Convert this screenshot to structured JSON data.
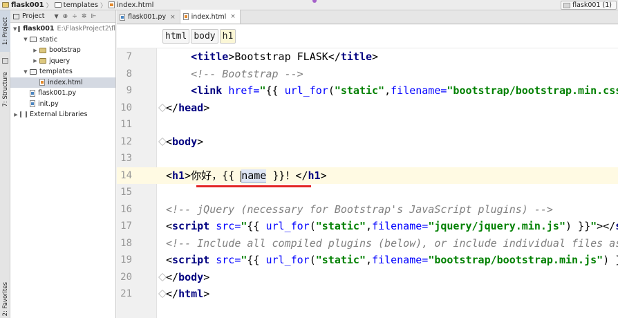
{
  "breadcrumb": [
    {
      "label": "flask001",
      "icon": "folder-icon",
      "bold": true
    },
    {
      "label": "templates",
      "icon": "folder-outline-icon",
      "bold": false
    },
    {
      "label": "index.html",
      "icon": "html-file-icon",
      "bold": false
    }
  ],
  "run_config": {
    "label": "flask001 (1)"
  },
  "toolstrip": {
    "project_tab": "1: Project",
    "structure_tab": "7: Structure",
    "favorites_tab": "2: Favorites"
  },
  "project_panel": {
    "title": "Project",
    "tree": [
      {
        "label": "flask001",
        "hint": "E:\\FlaskProject2\\fl",
        "type": "folder-open",
        "depth": 0,
        "expanded": true,
        "bold": true
      },
      {
        "label": "static",
        "type": "folder-open",
        "depth": 1,
        "expanded": true
      },
      {
        "label": "bootstrap",
        "type": "folder",
        "depth": 2,
        "expanded": false
      },
      {
        "label": "jquery",
        "type": "folder",
        "depth": 2,
        "expanded": false
      },
      {
        "label": "templates",
        "type": "folder-open",
        "depth": 1,
        "expanded": true
      },
      {
        "label": "index.html",
        "type": "html",
        "depth": 2,
        "selected": true
      },
      {
        "label": "flask001.py",
        "type": "py",
        "depth": 1
      },
      {
        "label": "init.py",
        "type": "py",
        "depth": 1
      },
      {
        "label": "External Libraries",
        "type": "lib",
        "depth": 0,
        "expanded": false
      }
    ]
  },
  "tabs": [
    {
      "label": "flask001.py",
      "icon": "python-file-icon",
      "active": false
    },
    {
      "label": "index.html",
      "icon": "html-file-icon",
      "active": true
    }
  ],
  "tag_breadcrumb": [
    "html",
    "body",
    "h1"
  ],
  "code_lines": [
    {
      "n": "7",
      "fold": false,
      "parts": [
        [
          "tg",
          "    <title"
        ],
        [
          "tx",
          ">Bootstrap FLASK</"
        ],
        [
          "tg",
          "title"
        ],
        [
          "tx",
          ">"
        ]
      ]
    },
    {
      "n": "8",
      "fold": false,
      "parts": [
        [
          "cm",
          "    <!-- Bootstrap -->"
        ]
      ]
    },
    {
      "n": "9",
      "fold": false,
      "parts": [
        [
          "tg",
          "    <link "
        ],
        [
          "at",
          "href="
        ],
        [
          "str",
          "\""
        ],
        [
          "tx",
          "{{ "
        ],
        [
          "at",
          "url_for"
        ],
        [
          "tx",
          "("
        ],
        [
          "str",
          "\"static\""
        ],
        [
          "tx",
          ","
        ],
        [
          "at",
          "filename="
        ],
        [
          "str",
          "\"bootstrap/bootstrap.min.css\""
        ],
        [
          "tx",
          ")"
        ]
      ]
    },
    {
      "n": "10",
      "fold": true,
      "parts": [
        [
          "tx",
          "</"
        ],
        [
          "tg",
          "head"
        ],
        [
          "tx",
          ">"
        ]
      ]
    },
    {
      "n": "11",
      "fold": false,
      "parts": []
    },
    {
      "n": "12",
      "fold": true,
      "parts": [
        [
          "tx",
          "<"
        ],
        [
          "tg",
          "body"
        ],
        [
          "tx",
          ">"
        ]
      ]
    },
    {
      "n": "13",
      "fold": false,
      "parts": []
    },
    {
      "n": "14",
      "fold": false,
      "current": true,
      "parts": [
        [
          "tx",
          "<"
        ],
        [
          "tg",
          "h1"
        ],
        [
          "tx",
          ">你好，{{ "
        ],
        [
          "caret",
          ""
        ],
        [
          "hl",
          "name"
        ],
        [
          "tx",
          " }}！</"
        ],
        [
          "tg",
          "h1"
        ],
        [
          "tx",
          ">"
        ]
      ]
    },
    {
      "n": "15",
      "fold": false,
      "parts": []
    },
    {
      "n": "16",
      "fold": false,
      "parts": [
        [
          "cm",
          "<!-- jQuery (necessary for Bootstrap's JavaScript plugins) -->"
        ]
      ]
    },
    {
      "n": "17",
      "fold": false,
      "parts": [
        [
          "tx",
          "<"
        ],
        [
          "tg",
          "script "
        ],
        [
          "at",
          "src="
        ],
        [
          "str",
          "\""
        ],
        [
          "tx",
          "{{ "
        ],
        [
          "at",
          "url_for"
        ],
        [
          "tx",
          "("
        ],
        [
          "str",
          "\"static\""
        ],
        [
          "tx",
          ","
        ],
        [
          "at",
          "filename="
        ],
        [
          "str",
          "\"jquery/jquery.min.js\""
        ],
        [
          "tx",
          ") }}"
        ],
        [
          "str",
          "\""
        ],
        [
          "tx",
          "></"
        ],
        [
          "tg",
          "scr"
        ]
      ]
    },
    {
      "n": "18",
      "fold": false,
      "parts": [
        [
          "cm",
          "<!-- Include all compiled plugins (below), or include individual files as needed"
        ]
      ]
    },
    {
      "n": "19",
      "fold": false,
      "parts": [
        [
          "tx",
          "<"
        ],
        [
          "tg",
          "script "
        ],
        [
          "at",
          "src="
        ],
        [
          "str",
          "\""
        ],
        [
          "tx",
          "{{ "
        ],
        [
          "at",
          "url_for"
        ],
        [
          "tx",
          "("
        ],
        [
          "str",
          "\"static\""
        ],
        [
          "tx",
          ","
        ],
        [
          "at",
          "filename="
        ],
        [
          "str",
          "\"bootstrap/bootstrap.min.js\""
        ],
        [
          "tx",
          ") }}"
        ],
        [
          "str",
          "\""
        ]
      ]
    },
    {
      "n": "20",
      "fold": true,
      "parts": [
        [
          "tx",
          "</"
        ],
        [
          "tg",
          "body"
        ],
        [
          "tx",
          ">"
        ]
      ]
    },
    {
      "n": "21",
      "fold": true,
      "parts": [
        [
          "tx",
          "</"
        ],
        [
          "tg",
          "html"
        ],
        [
          "tx",
          ">"
        ]
      ]
    }
  ],
  "colors": {
    "underline": "#e32424",
    "tag": "#000080",
    "string": "#008000",
    "comment": "#808080"
  }
}
